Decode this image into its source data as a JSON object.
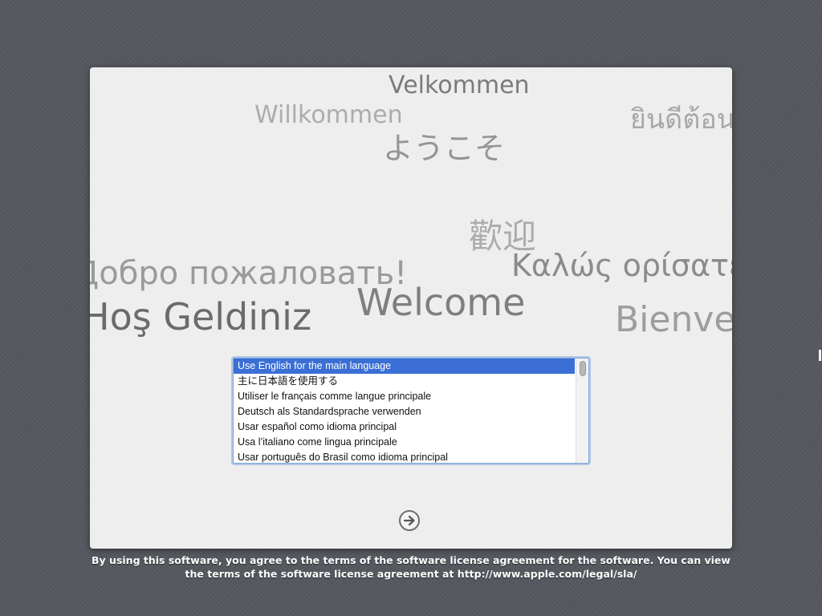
{
  "greetings": {
    "velkommen": "Velkommen",
    "willkommen": "Willkommen",
    "thai": "ยินดีต้อนรับ",
    "japanese": "ようこそ",
    "chinese": "歡迎",
    "russian": "Добро пожаловать!",
    "greek": "Καλώς ορίσατε",
    "welcome": "Welcome",
    "turkish": "Hoş Geldiniz",
    "french": "Bienvenue"
  },
  "language_list": {
    "items": [
      "Use English for the main language",
      "主に日本語を使用する",
      "Utiliser le français comme langue principale",
      "Deutsch als Standardsprache verwenden",
      "Usar español como idioma principal",
      "Usa l’italiano come lingua principale",
      "Usar português do Brasil como idioma principal"
    ],
    "selected_index": 0
  },
  "continue_button": {
    "icon": "arrow-right-circle-icon"
  },
  "footer": {
    "line1": "By using this software, you agree to the terms of the software license agreement for the software. You can view",
    "line2": "the terms of the software license agreement at http://www.apple.com/legal/sla/"
  },
  "colors": {
    "background": "#55585e",
    "panel": "#eeeeee",
    "selection": "#3b6fd5",
    "footer_text": "#ffffff"
  }
}
